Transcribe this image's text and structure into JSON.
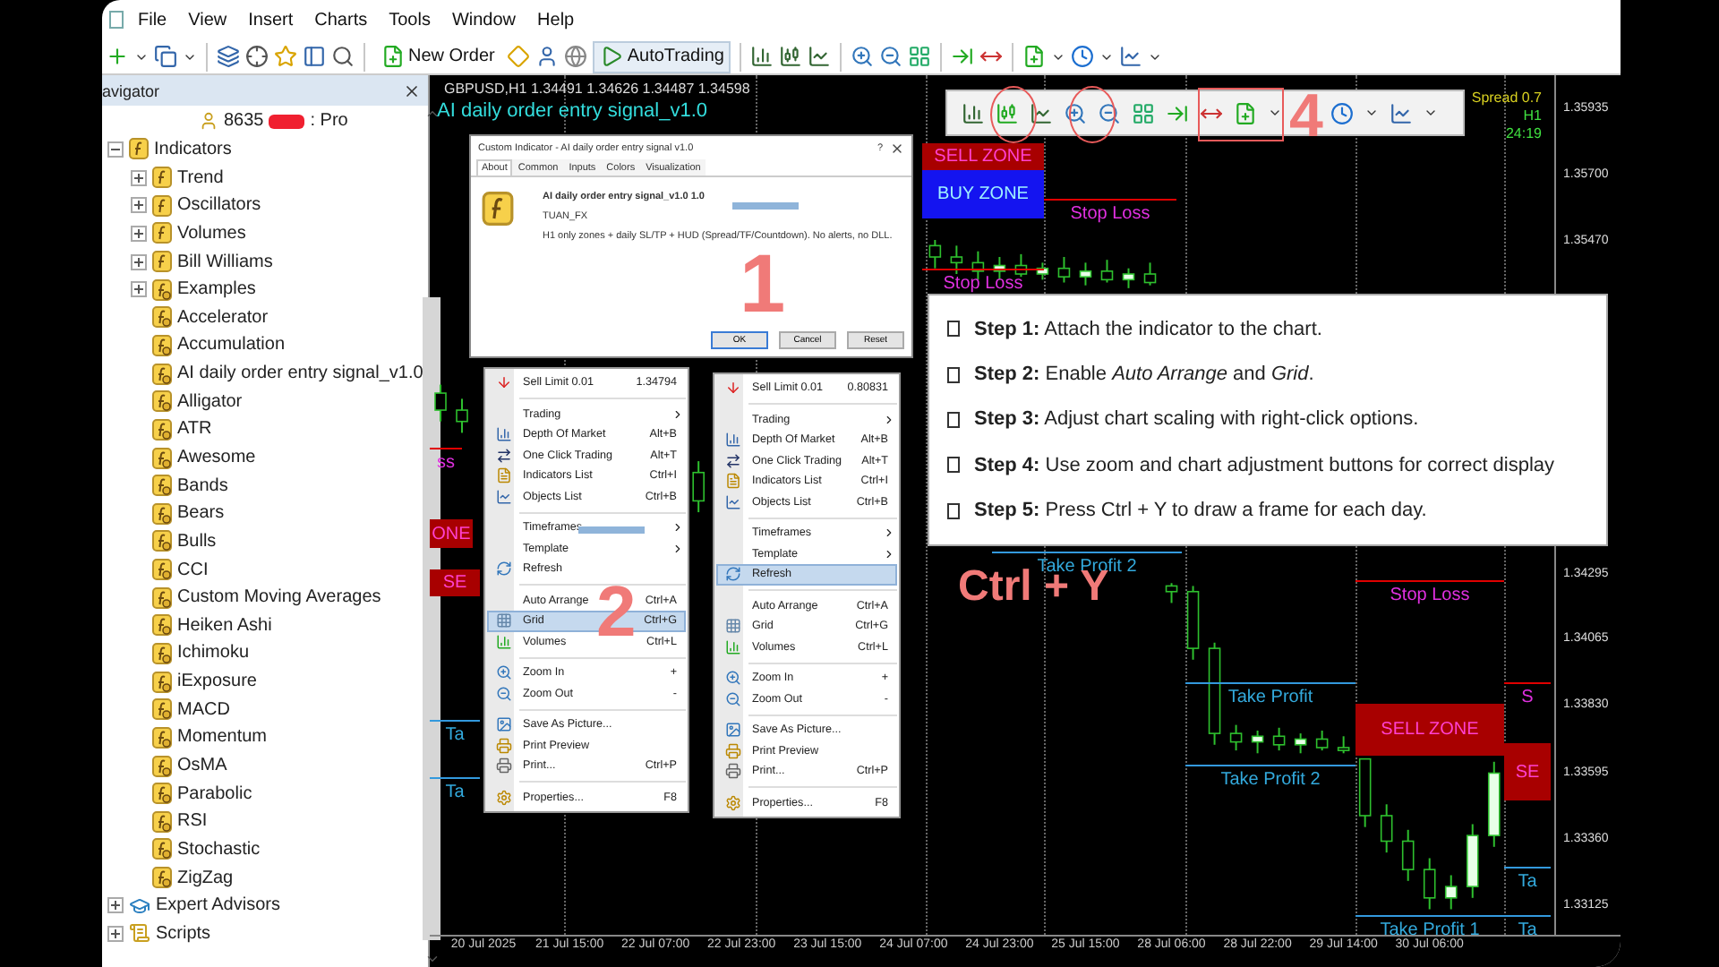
{
  "menu_bar": [
    "File",
    "View",
    "Insert",
    "Charts",
    "Tools",
    "Window",
    "Help"
  ],
  "toolbar": {
    "new_order": "New Order",
    "auto_trading": "AutoTrading"
  },
  "navigator": {
    "title": "avigator",
    "account": {
      "number": "8635",
      "type": ": Pro"
    },
    "tree": [
      {
        "kind": "indicators",
        "label": "Indicators",
        "expanded": true,
        "children": [
          {
            "kind": "group",
            "label": "Trend",
            "expanded": false
          },
          {
            "kind": "group",
            "label": "Oscillators",
            "expanded": false
          },
          {
            "kind": "group",
            "label": "Volumes",
            "expanded": false
          },
          {
            "kind": "group",
            "label": "Bill Williams",
            "expanded": false
          },
          {
            "kind": "custom_group",
            "label": "Examples",
            "expanded": false
          },
          {
            "kind": "indicator",
            "label": "Accelerator"
          },
          {
            "kind": "indicator",
            "label": "Accumulation"
          },
          {
            "kind": "indicator",
            "label": "AI daily order entry signal_v1.0"
          },
          {
            "kind": "indicator",
            "label": "Alligator"
          },
          {
            "kind": "indicator",
            "label": "ATR"
          },
          {
            "kind": "indicator",
            "label": "Awesome"
          },
          {
            "kind": "indicator",
            "label": "Bands"
          },
          {
            "kind": "indicator",
            "label": "Bears"
          },
          {
            "kind": "indicator",
            "label": "Bulls"
          },
          {
            "kind": "indicator",
            "label": "CCI"
          },
          {
            "kind": "indicator",
            "label": "Custom Moving Averages"
          },
          {
            "kind": "indicator",
            "label": "Heiken Ashi"
          },
          {
            "kind": "indicator",
            "label": "Ichimoku"
          },
          {
            "kind": "indicator",
            "label": "iExposure"
          },
          {
            "kind": "indicator",
            "label": "MACD"
          },
          {
            "kind": "indicator",
            "label": "Momentum"
          },
          {
            "kind": "indicator",
            "label": "OsMA"
          },
          {
            "kind": "indicator",
            "label": "Parabolic"
          },
          {
            "kind": "indicator",
            "label": "RSI"
          },
          {
            "kind": "indicator",
            "label": "Stochastic"
          },
          {
            "kind": "indicator",
            "label": "ZigZag"
          }
        ]
      },
      {
        "kind": "experts",
        "label": "Expert Advisors",
        "expanded": false
      },
      {
        "kind": "scripts",
        "label": "Scripts",
        "expanded": false
      }
    ]
  },
  "chart": {
    "symbol_line": "GBPUSD,H1 1.34491 1.34626 1.34487 1.34598",
    "indicator": "AI daily order entry signal_v1.0",
    "info": [
      "Spread 0.7",
      "H1",
      "24:19"
    ],
    "markers": [
      {
        "kind": "sell_zone",
        "text": "SELL ZONE"
      },
      {
        "kind": "buy_zone",
        "text": "BUY ZONE"
      },
      {
        "kind": "stop_loss",
        "text": "Stop Loss"
      },
      {
        "kind": "stop_loss",
        "text": "Stop Loss"
      },
      {
        "kind": "take_profit",
        "text": "Take Profit 2"
      },
      {
        "kind": "stop_loss",
        "text": "Stop Loss"
      },
      {
        "kind": "take_profit",
        "text": "Take Profit"
      },
      {
        "kind": "take_profit",
        "text": "Take Profit 2"
      },
      {
        "kind": "sell_zone",
        "text": "SELL ZONE"
      },
      {
        "kind": "take_profit",
        "text": "Take Profit 1"
      },
      {
        "kind": "stop_loss",
        "text": "ss"
      },
      {
        "kind": "sell_zone",
        "text": "ONE"
      },
      {
        "kind": "sell_zone",
        "text": "SE"
      },
      {
        "kind": "take_profit",
        "text": "Ta"
      },
      {
        "kind": "take_profit",
        "text": "Ta"
      },
      {
        "kind": "stop_loss",
        "text": "S"
      },
      {
        "kind": "sell_zone",
        "text": "SE"
      },
      {
        "kind": "take_profit",
        "text": "Ta"
      },
      {
        "kind": "take_profit",
        "text": "Ta"
      }
    ],
    "chart_data": {
      "type": "candlestick",
      "categories": [
        null,
        null,
        "20 Jul 2025",
        null,
        null,
        null,
        "21 Jul 15:00",
        null,
        null,
        null,
        "22 Jul 07:00",
        null,
        null,
        null,
        "22 Jul 23:00",
        null,
        null,
        null,
        "23 Jul 15:00",
        null,
        null,
        null,
        "24 Jul 07:00",
        null,
        null,
        null,
        "24 Jul 23:00",
        null,
        null,
        null,
        "25 Jul 15:00",
        null,
        null,
        null,
        "28 Jul 06:00",
        null,
        null,
        null,
        "28 Jul 22:00",
        null,
        null,
        null,
        "29 Jul 14:00",
        null,
        null,
        null,
        "30 Jul 06:00",
        null,
        null,
        null,
        null,
        null
      ],
      "ohlc": [
        [
          1.3494,
          1.3497,
          1.3484,
          1.3488
        ],
        [
          1.3488,
          1.3492,
          1.348,
          1.3484
        ],
        null,
        null,
        null,
        null,
        null,
        null,
        null,
        null,
        null,
        null,
        [
          1.3466,
          1.347,
          1.3452,
          1.3456
        ],
        null,
        null,
        null,
        null,
        null,
        null,
        null,
        null,
        null,
        null,
        [
          1.3546,
          1.3548,
          1.3538,
          1.3542
        ],
        [
          1.3542,
          1.3546,
          1.3536,
          1.354
        ],
        [
          1.354,
          1.3544,
          1.3534,
          1.3537
        ],
        [
          1.3537,
          1.3542,
          1.3534,
          1.3539
        ],
        [
          1.3539,
          1.3543,
          1.3535,
          1.3536
        ],
        [
          1.3536,
          1.354,
          1.3534,
          1.3538
        ],
        [
          1.3538,
          1.3542,
          1.3533,
          1.3535
        ],
        [
          1.3535,
          1.354,
          1.3532,
          1.3537
        ],
        [
          1.3537,
          1.3541,
          1.3533,
          1.3534
        ],
        [
          1.3534,
          1.3538,
          1.3531,
          1.3536
        ],
        [
          1.3536,
          1.354,
          1.3532,
          1.3533
        ],
        [
          1.3426,
          1.3427,
          1.342,
          1.3424
        ],
        [
          1.3424,
          1.3426,
          1.34,
          1.3404
        ],
        [
          1.3404,
          1.3406,
          1.337,
          1.3374
        ],
        [
          1.3374,
          1.3377,
          1.3368,
          1.3371
        ],
        [
          1.3371,
          1.3375,
          1.3367,
          1.3373
        ],
        [
          1.3373,
          1.3376,
          1.3368,
          1.337
        ],
        [
          1.337,
          1.3374,
          1.3367,
          1.3372
        ],
        [
          1.3372,
          1.3375,
          1.3368,
          1.3369
        ],
        [
          1.3369,
          1.3373,
          1.3367,
          1.3368
        ],
        [
          1.3365,
          1.3365,
          1.3341,
          1.3345
        ],
        [
          1.3345,
          1.3349,
          1.3332,
          1.3336
        ],
        [
          1.3336,
          1.334,
          1.3322,
          1.3326
        ],
        [
          1.3326,
          1.333,
          1.3312,
          1.3316
        ],
        [
          1.3316,
          1.3324,
          1.3312,
          1.332
        ],
        [
          1.332,
          1.3342,
          1.3316,
          1.3338
        ],
        [
          1.3338,
          1.3364,
          1.3334,
          1.336
        ],
        null,
        null
      ],
      "ylim": [
        1.3303,
        1.36061
      ],
      "yticks": [
        {
          "value": 1.35935,
          "label": "1.35935"
        },
        {
          "value": 1.357,
          "label": "1.35700"
        },
        {
          "value": 1.3547,
          "label": "1.35470"
        },
        {
          "value": 1.34295,
          "label": "1.34295"
        },
        {
          "value": 1.34065,
          "label": "1.34065"
        },
        {
          "value": 1.3383,
          "label": "1.33830"
        },
        {
          "value": 1.33595,
          "label": "1.33595"
        },
        {
          "value": 1.3336,
          "label": "1.33360"
        },
        {
          "value": 1.33125,
          "label": "1.33125"
        }
      ]
    }
  },
  "dialog": {
    "title": "Custom Indicator - AI daily order entry signal v1.0",
    "help": "?",
    "tabs": [
      {
        "label": "About",
        "selected": true
      },
      {
        "label": "Common",
        "selected": false
      },
      {
        "label": "Inputs",
        "selected": false
      },
      {
        "label": "Colors",
        "selected": false
      },
      {
        "label": "Visualization",
        "selected": false
      }
    ],
    "name": "AI daily order entry signal_v1.0 1.0",
    "author": "TUAN_FX",
    "description": "H1 only zones + daily SL/TP + HUD (Spread/TF/Countdown). No alerts, no DLL.",
    "buttons": [
      "OK",
      "Cancel",
      "Reset"
    ]
  },
  "context_menus": [
    {
      "items": [
        {
          "kind": "item",
          "label": "Sell Limit 0.01",
          "shortcut": "1.34794",
          "submenu": false,
          "selected": false
        },
        {
          "kind": "separator"
        },
        {
          "kind": "item",
          "label": "Trading",
          "submenu": true,
          "selected": false
        },
        {
          "kind": "item",
          "label": "Depth Of Market",
          "shortcut": "Alt+B",
          "submenu": false,
          "selected": false
        },
        {
          "kind": "item",
          "label": "One Click Trading",
          "shortcut": "Alt+T",
          "submenu": false,
          "selected": false
        },
        {
          "kind": "item",
          "label": "Indicators List",
          "shortcut": "Ctrl+I",
          "submenu": false,
          "selected": false
        },
        {
          "kind": "item",
          "label": "Objects List",
          "shortcut": "Ctrl+B",
          "submenu": false,
          "selected": false
        },
        {
          "kind": "separator"
        },
        {
          "kind": "item",
          "label": "Timeframes",
          "submenu": true,
          "selected": false
        },
        {
          "kind": "item",
          "label": "Template",
          "submenu": true,
          "selected": false
        },
        {
          "kind": "item",
          "label": "Refresh",
          "submenu": false,
          "selected": false
        },
        {
          "kind": "separator"
        },
        {
          "kind": "item",
          "label": "Auto Arrange",
          "shortcut": "Ctrl+A",
          "submenu": false,
          "selected": false
        },
        {
          "kind": "item",
          "label": "Grid",
          "shortcut": "Ctrl+G",
          "submenu": false,
          "selected": true
        },
        {
          "kind": "item",
          "label": "Volumes",
          "shortcut": "Ctrl+L",
          "submenu": false,
          "selected": false
        },
        {
          "kind": "separator"
        },
        {
          "kind": "item",
          "label": "Zoom In",
          "shortcut": "+",
          "submenu": false,
          "selected": false
        },
        {
          "kind": "item",
          "label": "Zoom Out",
          "shortcut": "-",
          "submenu": false,
          "selected": false
        },
        {
          "kind": "separator"
        },
        {
          "kind": "item",
          "label": "Save As Picture...",
          "submenu": false,
          "selected": false
        },
        {
          "kind": "item",
          "label": "Print Preview",
          "submenu": false,
          "selected": false
        },
        {
          "kind": "item",
          "label": "Print...",
          "shortcut": "Ctrl+P",
          "submenu": false,
          "selected": false
        },
        {
          "kind": "separator"
        },
        {
          "kind": "item",
          "label": "Properties...",
          "shortcut": "F8",
          "submenu": false,
          "selected": false
        }
      ]
    },
    {
      "items": [
        {
          "kind": "item",
          "label": "Sell Limit 0.01",
          "shortcut": "0.80831",
          "submenu": false,
          "selected": false
        },
        {
          "kind": "separator"
        },
        {
          "kind": "item",
          "label": "Trading",
          "submenu": true,
          "selected": false
        },
        {
          "kind": "item",
          "label": "Depth Of Market",
          "shortcut": "Alt+B",
          "submenu": false,
          "selected": false
        },
        {
          "kind": "item",
          "label": "One Click Trading",
          "shortcut": "Alt+T",
          "submenu": false,
          "selected": false
        },
        {
          "kind": "item",
          "label": "Indicators List",
          "shortcut": "Ctrl+I",
          "submenu": false,
          "selected": false
        },
        {
          "kind": "item",
          "label": "Objects List",
          "shortcut": "Ctrl+B",
          "submenu": false,
          "selected": false
        },
        {
          "kind": "separator"
        },
        {
          "kind": "item",
          "label": "Timeframes",
          "submenu": true,
          "selected": false
        },
        {
          "kind": "item",
          "label": "Template",
          "submenu": true,
          "selected": false
        },
        {
          "kind": "item",
          "label": "Refresh",
          "submenu": false,
          "selected": true
        },
        {
          "kind": "separator"
        },
        {
          "kind": "item",
          "label": "Auto Arrange",
          "shortcut": "Ctrl+A",
          "submenu": false,
          "selected": false
        },
        {
          "kind": "item",
          "label": "Grid",
          "shortcut": "Ctrl+G",
          "submenu": false,
          "selected": false
        },
        {
          "kind": "item",
          "label": "Volumes",
          "shortcut": "Ctrl+L",
          "submenu": false,
          "selected": false
        },
        {
          "kind": "separator"
        },
        {
          "kind": "item",
          "label": "Zoom In",
          "shortcut": "+",
          "submenu": false,
          "selected": false
        },
        {
          "kind": "item",
          "label": "Zoom Out",
          "shortcut": "-",
          "submenu": false,
          "selected": false
        },
        {
          "kind": "separator"
        },
        {
          "kind": "item",
          "label": "Save As Picture...",
          "submenu": false,
          "selected": false
        },
        {
          "kind": "item",
          "label": "Print Preview",
          "submenu": false,
          "selected": false
        },
        {
          "kind": "item",
          "label": "Print...",
          "shortcut": "Ctrl+P",
          "submenu": false,
          "selected": false
        },
        {
          "kind": "separator"
        },
        {
          "kind": "item",
          "label": "Properties...",
          "shortcut": "F8",
          "submenu": false,
          "selected": false
        }
      ]
    }
  ],
  "steps": [
    "**Step 1:** Attach the indicator to the chart.",
    "**Step 2:** Enable *Auto Arrange* and *Grid*.",
    "**Step 3:** Adjust chart scaling with right-click options.",
    "**Step 4:** Use zoom and chart adjustment buttons for correct display",
    "**Step 5:** Press Ctrl + Y to draw a frame for each day."
  ],
  "annotations": {
    "dialog_step": "1",
    "menu_step": "2",
    "toolbar_step": "4",
    "shortcut": "Ctrl + Y"
  }
}
